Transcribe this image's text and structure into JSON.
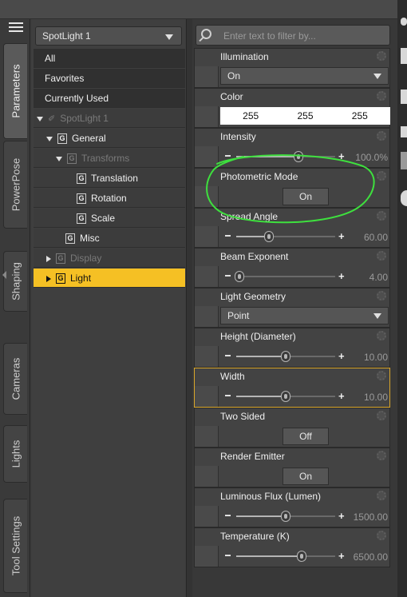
{
  "vertical_tabs": [
    {
      "label": "Parameters",
      "active": true
    },
    {
      "label": "PowerPose",
      "active": false
    },
    {
      "label": "Shaping",
      "active": false
    },
    {
      "label": "Cameras",
      "active": false
    },
    {
      "label": "Lights",
      "active": false
    },
    {
      "label": "Tool Settings",
      "active": false
    }
  ],
  "node_select": {
    "value": "SpotLight 1"
  },
  "filter": {
    "placeholder": "Enter text to filter by..."
  },
  "tree": {
    "categories": [
      "All",
      "Favorites",
      "Currently Used"
    ],
    "node": "SpotLight 1",
    "groups": {
      "general": "General",
      "transforms": "Transforms",
      "translation": "Translation",
      "rotation": "Rotation",
      "scale": "Scale",
      "misc": "Misc",
      "display": "Display",
      "light": "Light"
    },
    "group_icon": "G"
  },
  "params": {
    "illumination": {
      "label": "Illumination",
      "value": "On"
    },
    "color": {
      "label": "Color",
      "r": "255",
      "g": "255",
      "b": "255"
    },
    "intensity": {
      "label": "Intensity",
      "value": "100.0%",
      "level": 0.63
    },
    "photometric": {
      "label": "Photometric Mode",
      "value": "On"
    },
    "spread": {
      "label": "Spread Angle",
      "value": "60.00",
      "level": 0.33
    },
    "beam": {
      "label": "Beam Exponent",
      "value": "4.00",
      "level": 0.03
    },
    "geometry": {
      "label": "Light Geometry",
      "value": "Point"
    },
    "height": {
      "label": "Height (Diameter)",
      "value": "10.00",
      "level": 0.5
    },
    "width": {
      "label": "Width",
      "value": "10.00",
      "level": 0.5
    },
    "two_sided": {
      "label": "Two Sided",
      "value": "Off"
    },
    "render_emitter": {
      "label": "Render Emitter",
      "value": "On"
    },
    "flux": {
      "label": "Luminous Flux (Lumen)",
      "value": "1500.00",
      "level": 0.5
    },
    "temperature": {
      "label": "Temperature (K)",
      "value": "6500.00",
      "level": 0.66
    }
  },
  "colors": {
    "selection": "#f5c024",
    "highlight_border": "#d9a62a",
    "annotation": "#3ee03e"
  },
  "icons": [
    "menu-icon",
    "search-icon",
    "gear-icon",
    "pin-icon",
    "group-icon"
  ]
}
